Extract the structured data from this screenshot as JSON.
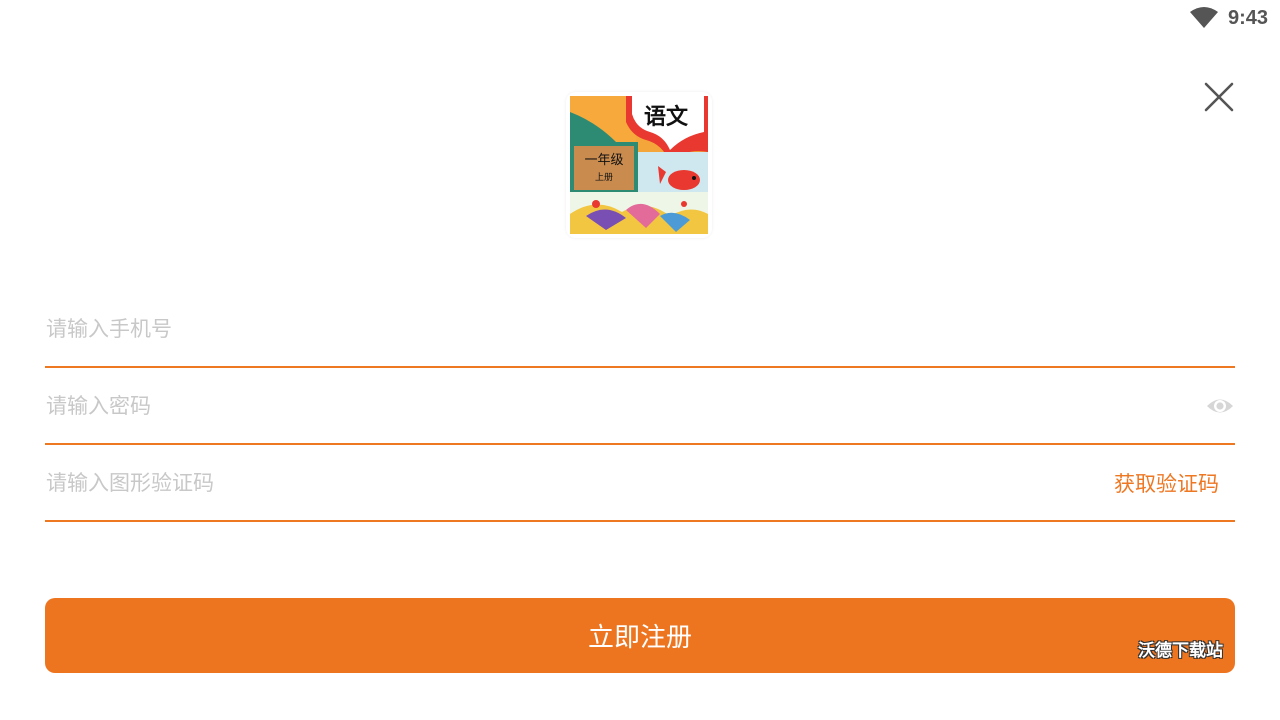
{
  "status_bar": {
    "time": "9:43",
    "wifi_icon": "wifi-icon"
  },
  "close_icon": "close-icon",
  "logo": {
    "title": "语文",
    "grade": "一年级",
    "volume": "上册"
  },
  "form": {
    "phone_placeholder": "请输入手机号",
    "password_placeholder": "请输入密码",
    "captcha_placeholder": "请输入图形验证码",
    "get_code_label": "获取验证码",
    "eye_icon": "eye-icon"
  },
  "register_button": {
    "label": "立即注册"
  },
  "watermark": "沃德下载站",
  "colors": {
    "accent": "#EE7520",
    "placeholder": "#C8C8C8",
    "status_text": "#555555"
  }
}
